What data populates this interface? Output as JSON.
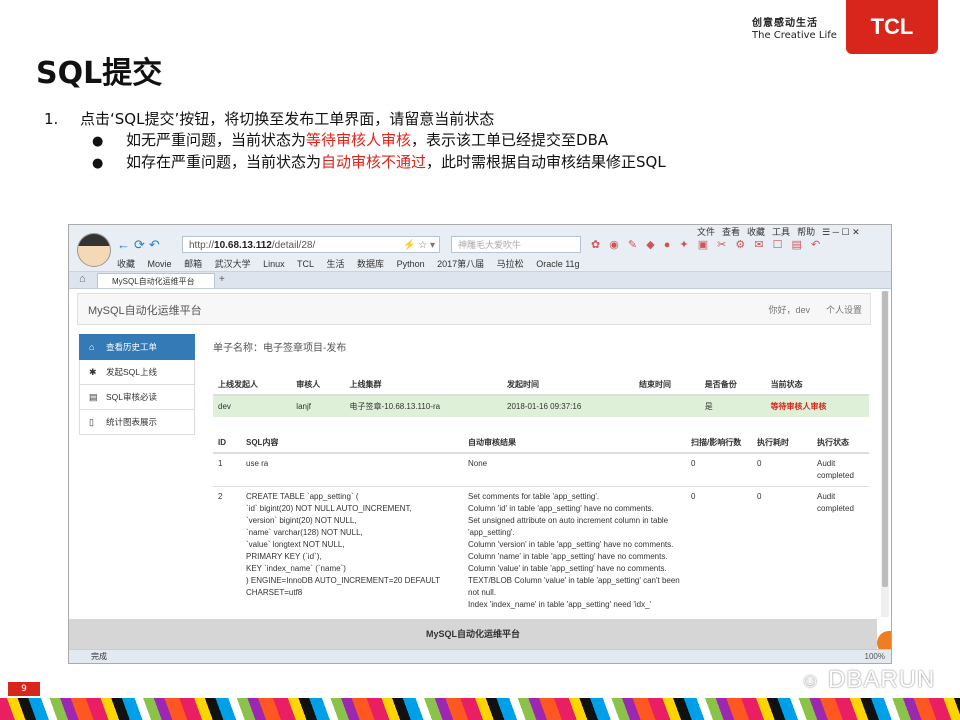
{
  "slide": {
    "title": "SQL提交",
    "slogan_cn": "创意感动生活",
    "slogan_en": "The Creative Life",
    "logo": "TCL",
    "page_number": "9",
    "watermark": "DBARUN"
  },
  "bullets": {
    "item1_num": "1.",
    "item1_text": "点击‘SQL提交’按钮，将切换至发布工单界面，请留意当前状态",
    "sub1_pre": "如无严重问题，当前状态为",
    "sub1_red": "等待审核人审核",
    "sub1_post": "，表示该工单已经提交至DBA",
    "sub2_pre": "如存在严重问题，当前状态为",
    "sub2_red": "自动审核不通过",
    "sub2_post": "，此时需根据自动审核结果修正SQL"
  },
  "browser": {
    "address_prefix": "http://",
    "address_host": "10.68.13.112",
    "address_path": "/detail/28/",
    "search_placeholder": "神雕毛大爱吹牛",
    "menu": [
      "文件",
      "查看",
      "收藏",
      "工具",
      "帮助"
    ],
    "bookmarks": [
      "收藏",
      "Movie",
      "邮箱",
      "武汉大学",
      "Linux",
      "TCL",
      "生活",
      "数据库",
      "Python",
      "2017第八届",
      "马拉松",
      "Oracle 11g"
    ],
    "tab_label": "MySQL自动化运维平台",
    "status_left": "完成",
    "zoom": "100%"
  },
  "app": {
    "title": "MySQL自动化运维平台",
    "user": "你好，dev",
    "settings": "个人设置",
    "sidebar": [
      "查看历史工单",
      "发起SQL上线",
      "SQL审核必读",
      "统计图表展示"
    ],
    "form_name_label": "单子名称：",
    "form_name": "电子签章项目-发布",
    "workflow_headers": [
      "上线发起人",
      "审核人",
      "上线集群",
      "发起时间",
      "结束时间",
      "是否备份",
      "当前状态"
    ],
    "workflow_row": [
      "dev",
      "lanjf",
      "电子签章-10.68.13.110-ra",
      "2018-01-16 09:37:16",
      "",
      "是",
      "等待审核人审核"
    ],
    "detail_headers": [
      "ID",
      "SQL内容",
      "自动审核结果",
      "扫描/影响行数",
      "执行耗时",
      "执行状态"
    ],
    "detail_rows": [
      {
        "id": "1",
        "sql": "use ra",
        "result": "None",
        "rows": "0",
        "time": "0",
        "status": "Audit completed"
      },
      {
        "id": "2",
        "sql": "CREATE TABLE `app_setting` (\n  `id` bigint(20) NOT NULL AUTO_INCREMENT,\n  `version` bigint(20) NOT NULL,\n  `name` varchar(128) NOT NULL,\n  `value` longtext NOT NULL,\n  PRIMARY KEY (`id`),\n  KEY `index_name` (`name`)\n) ENGINE=InnoDB AUTO_INCREMENT=20 DEFAULT CHARSET=utf8",
        "result": "Set comments for table 'app_setting'.\nColumn 'id' in table 'app_setting' have no comments.\nSet unsigned attribute on auto increment column in table 'app_setting'.\nColumn 'version' in table 'app_setting' have no comments.\nColumn 'name' in table 'app_setting' have no comments.\nColumn 'value' in table 'app_setting' have no comments.\nTEXT/BLOB Column 'value' in table 'app_setting' can't been not null.\nIndex 'index_name' in table 'app_setting' need 'idx_'",
        "rows": "0",
        "time": "0",
        "status": "Audit completed"
      }
    ],
    "footer": "MySQL自动化运维平台"
  },
  "colors": {
    "accent_red": "#d9261c",
    "primary_blue": "#337ab7",
    "success_row": "#dff0d8"
  }
}
